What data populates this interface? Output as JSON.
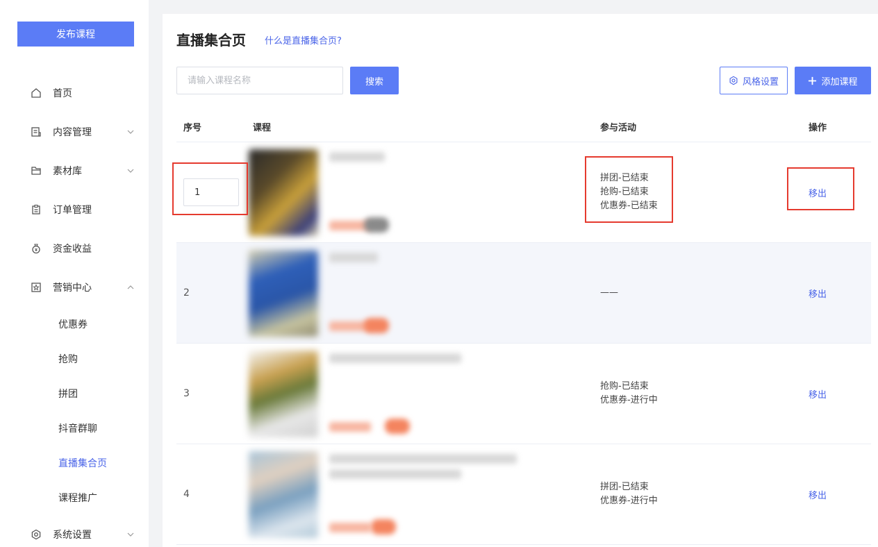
{
  "sidebar": {
    "publish_label": "发布课程",
    "items": [
      {
        "label": "首页",
        "icon": "home-icon"
      },
      {
        "label": "内容管理",
        "icon": "content-icon"
      },
      {
        "label": "素材库",
        "icon": "folder-icon"
      },
      {
        "label": "订单管理",
        "icon": "clipboard-icon"
      },
      {
        "label": "资金收益",
        "icon": "money-bag-icon"
      },
      {
        "label": "营销中心",
        "icon": "star-icon"
      },
      {
        "label": "系统设置",
        "icon": "gear-icon"
      }
    ],
    "sub_items": [
      {
        "label": "优惠券"
      },
      {
        "label": "抢购"
      },
      {
        "label": "拼团"
      },
      {
        "label": "抖音群聊"
      },
      {
        "label": "直播集合页",
        "active": true
      },
      {
        "label": "课程推广"
      }
    ]
  },
  "main": {
    "title": "直播集合页",
    "help_link": "什么是直播集合页?",
    "search_placeholder": "请输入课程名称",
    "search_label": "搜索",
    "style_label": "风格设置",
    "add_label": "添加课程",
    "columns": {
      "index": "序号",
      "course": "课程",
      "activities": "参与活动",
      "actions": "操作"
    },
    "rows": [
      {
        "index": "1",
        "activities": [
          "拼团-已结束",
          "抢购-已结束",
          "优惠券-已结束"
        ],
        "action": "移出"
      },
      {
        "index": "2",
        "activities": [
          "——"
        ],
        "action": "移出"
      },
      {
        "index": "3",
        "activities": [
          "抢购-已结束",
          "优惠券-进行中"
        ],
        "action": "移出"
      },
      {
        "index": "4",
        "activities": [
          "拼团-已结束",
          "优惠券-进行中"
        ],
        "action": "移出"
      }
    ]
  },
  "colors": {
    "accent": "#5b7cf6",
    "link": "#4a64e8",
    "highlight": "#e53a2e"
  }
}
